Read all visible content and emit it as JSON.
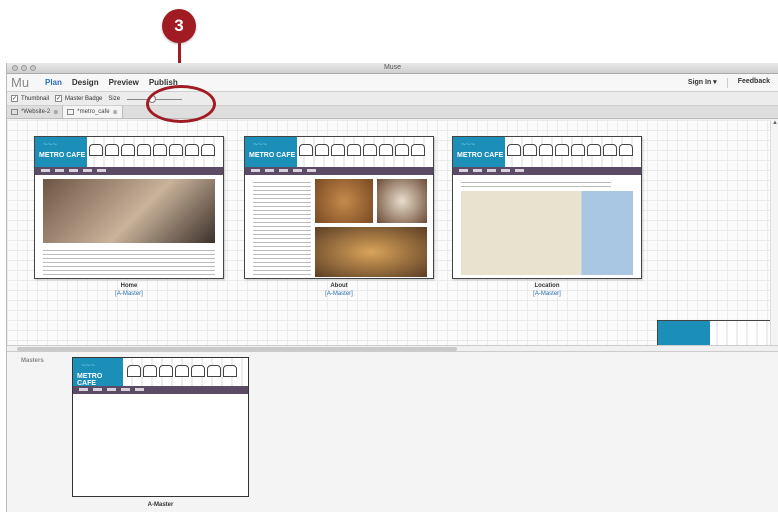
{
  "callout": {
    "number": "3"
  },
  "window": {
    "title": "Muse"
  },
  "menu": {
    "logo": "Mu",
    "nav": [
      "Plan",
      "Design",
      "Preview",
      "Publish"
    ],
    "sign_in": "Sign In ▾",
    "feedback": "Feedback"
  },
  "toolbar": {
    "thumbnail_label": "Thumbnail",
    "master_badge_label": "Master Badge",
    "size_label": "Size",
    "size_value": 0.45
  },
  "tabs": [
    "*Website-2",
    "*metro_cafe"
  ],
  "pages": [
    {
      "label": "Home",
      "master": "[A-Master]"
    },
    {
      "label": "About",
      "master": "[A-Master]"
    },
    {
      "label": "Location",
      "master": "[A-Master]"
    }
  ],
  "brand": {
    "name": "METRO CAFE"
  },
  "masters": {
    "title": "Masters",
    "items": [
      {
        "label": "A-Master"
      }
    ]
  },
  "colors": {
    "accent": "#a01c22",
    "brand": "#1c8fb8",
    "nav_purple": "#5b4b64",
    "link_blue": "#2a6fb5"
  }
}
